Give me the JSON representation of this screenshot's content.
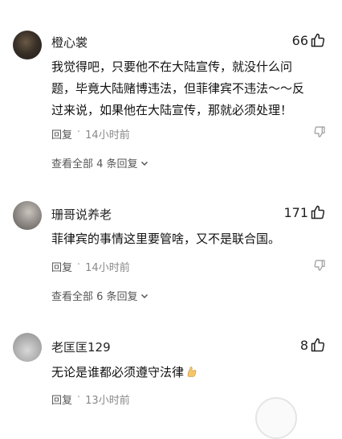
{
  "comments": [
    {
      "username": "橙心裳",
      "likes": "66",
      "lines": [
        "我觉得吧，只要他不在大陆宣传，就没什么问",
        "题，毕竟大陆赌博违法，但菲律宾不违法～～反",
        "过来说，如果他在大陆宣传，那就必须处理！"
      ],
      "reply_label": "回复",
      "separator": "·",
      "time": "14小时前",
      "view_replies": "查看全部 4 条回复"
    },
    {
      "username": "珊哥说养老",
      "likes": "171",
      "lines": [
        "菲律宾的事情这里要管啥，又不是联合国。"
      ],
      "reply_label": "回复",
      "separator": "·",
      "time": "14小时前",
      "view_replies": "查看全部 6 条回复"
    },
    {
      "username": "老匡匡129",
      "likes": "8",
      "lines": [
        "无论是谁都必须遵守法律"
      ],
      "reply_label": "回复",
      "separator": "·",
      "time": "13小时前"
    }
  ],
  "icons": {
    "like": "thumbs-up-icon",
    "dislike": "thumbs-down-icon",
    "chevron": "chevron-down-icon",
    "emoji": "flexed-biceps-emoji"
  }
}
